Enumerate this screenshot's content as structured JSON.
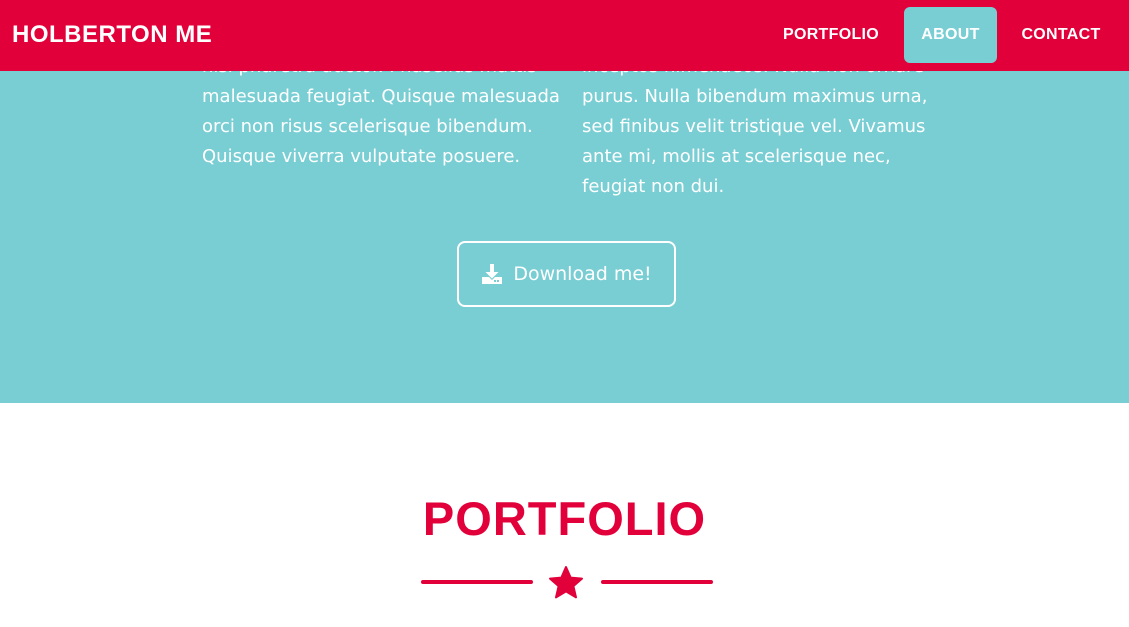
{
  "navbar": {
    "brand": "HOLBERTON ME",
    "items": [
      {
        "label": "PORTFOLIO",
        "active": false
      },
      {
        "label": "ABOUT",
        "active": true
      },
      {
        "label": "CONTACT",
        "active": false
      }
    ],
    "background_color": "#e1003a",
    "active_color": "#79ced4"
  },
  "about": {
    "background_color": "#79ced4",
    "left_column": {
      "lines": [
        "nisi pharetra auctor. Phasellus mattis",
        "malesuada feugiat. Quisque malesuada",
        "orci non risus scelerisque bibendum.",
        "Quisque viverra vulputate posuere."
      ]
    },
    "right_column": {
      "lines": [
        "inceptos himenaeos. Nulla non ornare",
        "purus. Nulla bibendum maximus urna,",
        "sed finibus velit tristique vel. Vivamus",
        "ante mi, mollis at scelerisque nec,",
        "feugiat non dui."
      ]
    },
    "download_button": {
      "label": "Download me!",
      "icon": "download-icon"
    }
  },
  "portfolio": {
    "title": "PORTFOLIO",
    "divider_icon": "star-icon",
    "accent_color": "#e1003a"
  }
}
